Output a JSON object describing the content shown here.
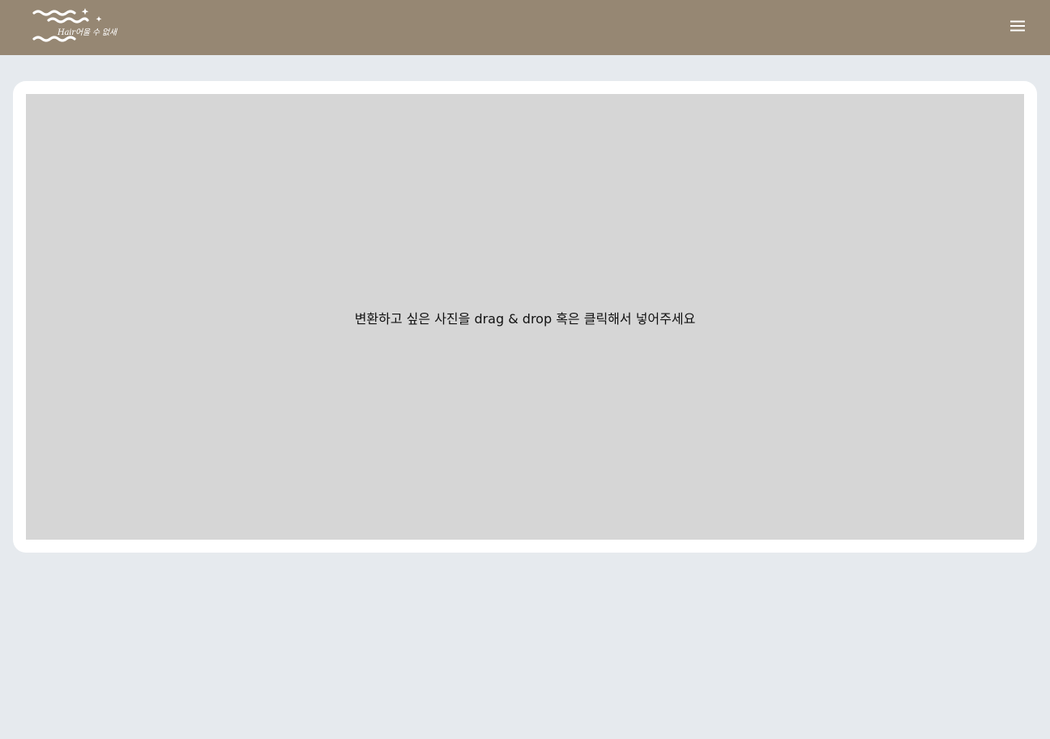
{
  "header": {
    "logo": {
      "icon": "wave-logo-icon",
      "text": "Hair어울 수 없새"
    },
    "menu_icon": "hamburger-menu-icon"
  },
  "main": {
    "dropzone": {
      "instruction": "변환하고 싶은 사진을 drag & drop 혹은 클릭해서 넣어주세요"
    }
  },
  "colors": {
    "header_bg": "#968773",
    "page_bg": "#e6eaee",
    "card_bg": "#ffffff",
    "dropzone_bg": "#d6d6d6"
  }
}
